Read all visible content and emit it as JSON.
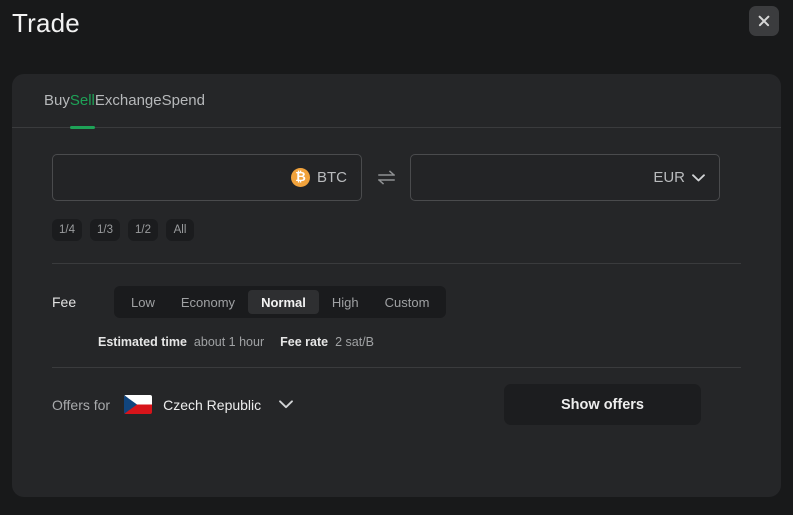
{
  "header": {
    "title": "Trade",
    "close_label": "×"
  },
  "tabs": [
    {
      "label": "Buy",
      "active": false
    },
    {
      "label": "Sell",
      "active": true
    },
    {
      "label": "Exchange",
      "active": false
    },
    {
      "label": "Spend",
      "active": false
    }
  ],
  "trade": {
    "from": {
      "value": "",
      "placeholder": "",
      "currency": "BTC",
      "icon": "bitcoin-icon",
      "icon_glyph": "₿",
      "icon_color": "#f2a33c"
    },
    "swap_icon": "swap-horizontal-icon",
    "to": {
      "value": "",
      "placeholder": "",
      "currency": "EUR",
      "icon": "chevron-down-icon"
    },
    "fractions": [
      "1/4",
      "1/3",
      "1/2",
      "All"
    ]
  },
  "fee": {
    "label": "Fee",
    "options": [
      {
        "label": "Low",
        "selected": false
      },
      {
        "label": "Economy",
        "selected": false
      },
      {
        "label": "Normal",
        "selected": true
      },
      {
        "label": "High",
        "selected": false
      },
      {
        "label": "Custom",
        "selected": false
      }
    ],
    "estimated_time_key": "Estimated time",
    "estimated_time_value": "about 1 hour",
    "fee_rate_key": "Fee rate",
    "fee_rate_value": "2 sat/B"
  },
  "offers": {
    "label": "Offers for",
    "country": "Czech Republic",
    "flag": "czech-republic-flag",
    "chevron": "chevron-down-icon",
    "button_label": "Show offers"
  },
  "colors": {
    "page_bg": "#18191a",
    "card_bg": "#252628",
    "accent_green": "#1ea257",
    "bitcoin_orange": "#f2a33c",
    "divider": "#3a3b3d"
  }
}
